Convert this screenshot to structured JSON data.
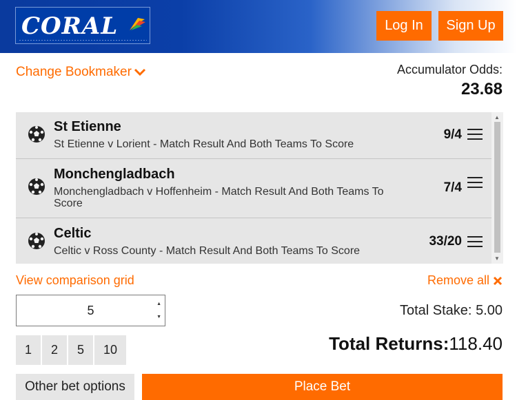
{
  "header": {
    "logo_text": "CORAL",
    "login_label": "Log In",
    "signup_label": "Sign Up"
  },
  "change_bookmaker": {
    "label": "Change Bookmaker",
    "icon": "chevron-down-icon"
  },
  "accumulator": {
    "label": "Accumulator Odds:",
    "value": "23.68"
  },
  "bets": [
    {
      "team": "St Etienne",
      "market": "St Etienne v Lorient - Match Result And Both Teams To Score",
      "odds": "9/4",
      "icon": "football-icon"
    },
    {
      "team": "Monchengladbach",
      "market": "Monchengladbach v Hoffenheim - Match Result And Both Teams To Score",
      "odds": "7/4",
      "icon": "football-icon"
    },
    {
      "team": "Celtic",
      "market": "Celtic v Ross County - Match Result And Both Teams To Score",
      "odds": "33/20",
      "icon": "football-icon"
    }
  ],
  "actions": {
    "view_comparison": "View comparison grid",
    "remove_all": "Remove all",
    "remove_icon": "close-icon"
  },
  "stake": {
    "value": "5",
    "total_stake_label": "Total Stake:",
    "total_stake_value": "5.00"
  },
  "quick_stakes": [
    "1",
    "2",
    "5",
    "10"
  ],
  "returns": {
    "label": "Total Returns:",
    "value": "118.40"
  },
  "footer": {
    "other_options_label": "Other bet options",
    "place_bet_label": "Place Bet"
  },
  "colors": {
    "brand_blue": "#0b3fa8",
    "accent_orange": "#ff6b00",
    "panel_grey": "#e6e6e6"
  }
}
